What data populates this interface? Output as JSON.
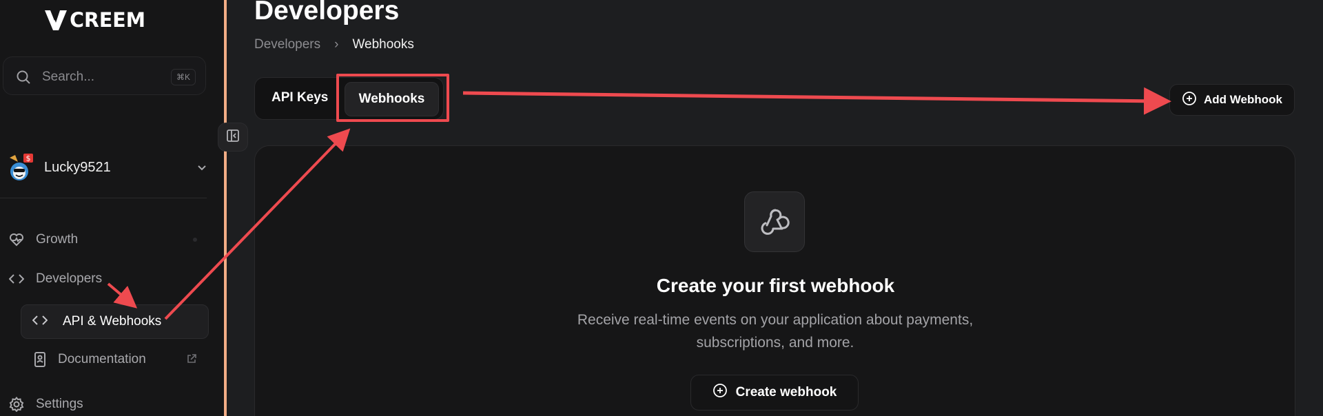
{
  "brand": {
    "logo_text": "CREEM"
  },
  "search": {
    "placeholder": "Search...",
    "shortcut": "⌘K"
  },
  "team": {
    "name": "Lucky9521",
    "avatar_badge": "$"
  },
  "nav": {
    "growth": "Growth",
    "developers": "Developers",
    "api_webhooks": "API & Webhooks",
    "documentation": "Documentation",
    "settings": "Settings"
  },
  "page": {
    "title": "Developers"
  },
  "breadcrumb": {
    "parent": "Developers",
    "separator": "›",
    "current": "Webhooks"
  },
  "tabs": [
    {
      "label": "API Keys"
    },
    {
      "label": "Webhooks",
      "active": true
    }
  ],
  "actions": {
    "add_webhook": "Add Webhook"
  },
  "empty_state": {
    "title": "Create your first webhook",
    "description": "Receive real-time events on your application about payments, subscriptions, and more.",
    "button": "Create webhook"
  },
  "colors": {
    "background": "#1d1e20",
    "sidebar": "#161617",
    "accent_bar": "#f2ad86",
    "annotation": "#ee4a4f"
  },
  "icons": {
    "search": "search-icon",
    "chevron": "chevron-down-icon",
    "growth": "heart-icon",
    "developers": "code-icon",
    "documentation": "book-icon",
    "external": "external-link-icon",
    "settings": "gear-icon",
    "collapse": "sidebar-collapse-icon",
    "webhook": "webhook-icon",
    "plus": "plus-circle-icon"
  }
}
